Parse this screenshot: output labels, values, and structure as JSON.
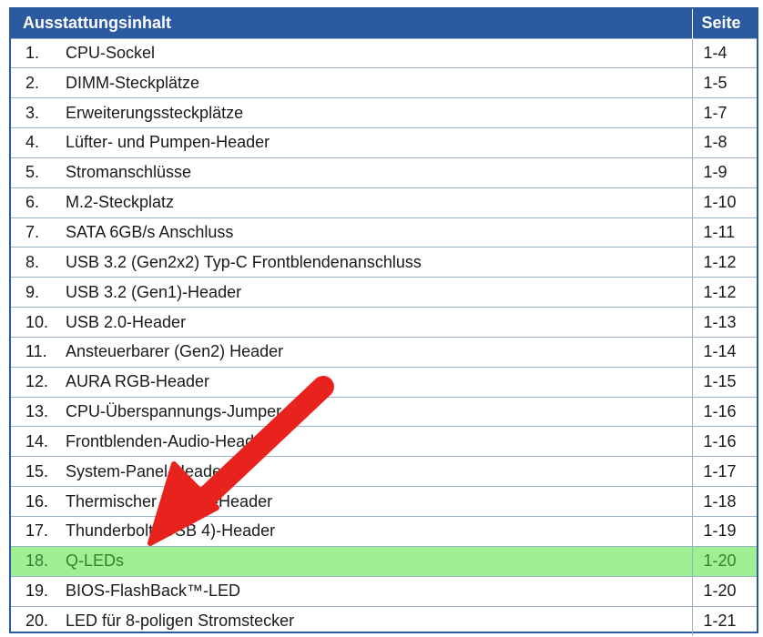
{
  "header": {
    "title": "Ausstattungsinhalt",
    "page": "Seite"
  },
  "rows": [
    {
      "num": "1.",
      "title": "CPU-Sockel",
      "page": "1-4"
    },
    {
      "num": "2.",
      "title": "DIMM-Steckplätze",
      "page": "1-5"
    },
    {
      "num": "3.",
      "title": "Erweiterungssteckplätze",
      "page": "1-7"
    },
    {
      "num": "4.",
      "title": "Lüfter- und Pumpen-Header",
      "page": "1-8"
    },
    {
      "num": "5.",
      "title": "Stromanschlüsse",
      "page": "1-9"
    },
    {
      "num": "6.",
      "title": "M.2-Steckplatz",
      "page": "1-10"
    },
    {
      "num": "7.",
      "title": "SATA 6GB/s Anschluss",
      "page": "1-11"
    },
    {
      "num": "8.",
      "title": "USB 3.2 (Gen2x2) Typ-C Frontblendenanschluss",
      "page": "1-12"
    },
    {
      "num": "9.",
      "title": "USB 3.2 (Gen1)-Header",
      "page": "1-12"
    },
    {
      "num": "10.",
      "title": "USB 2.0-Header",
      "page": "1-13"
    },
    {
      "num": "11.",
      "title": "Ansteuerbarer (Gen2) Header",
      "page": "1-14"
    },
    {
      "num": "12.",
      "title": "AURA RGB-Header",
      "page": "1-15"
    },
    {
      "num": "13.",
      "title": "CPU-Überspannungs-Jumper",
      "page": "1-16"
    },
    {
      "num": "14.",
      "title": "Frontblenden-Audio-Header",
      "page": "1-16"
    },
    {
      "num": "15.",
      "title": "System-Panel-Header",
      "page": "1-17"
    },
    {
      "num": "16.",
      "title": "Thermischer Sensor-Header",
      "page": "1-18"
    },
    {
      "num": "17.",
      "title": "Thunderbolt (USB 4)-Header",
      "page": "1-19"
    },
    {
      "num": "18.",
      "title": "Q-LEDs",
      "page": "1-20"
    },
    {
      "num": "19.",
      "title": "BIOS-FlashBack™-LED",
      "page": "1-20"
    },
    {
      "num": "20.",
      "title": "LED für 8-poligen Stromstecker",
      "page": "1-21"
    }
  ],
  "highlighted_row": "18.",
  "colors": {
    "header": "#2c5aa0",
    "highlight": "#9ff093",
    "arrow": "#e8231e"
  }
}
